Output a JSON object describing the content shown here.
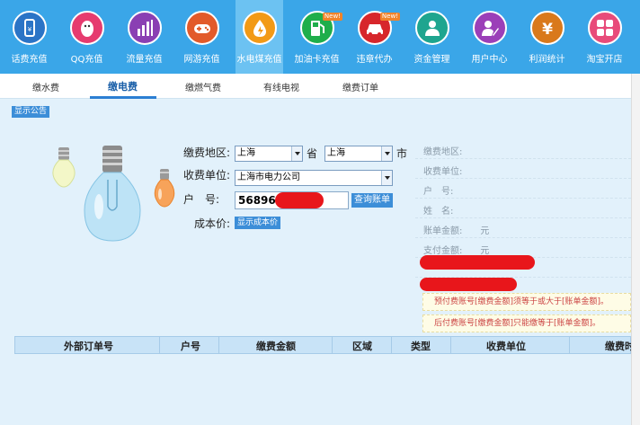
{
  "nav": {
    "items": [
      {
        "label": "话费充值",
        "icon": "phone-icon",
        "color": "#2b74c6",
        "new": false
      },
      {
        "label": "QQ充值",
        "icon": "qq-penguin-icon",
        "color": "#e63b6f",
        "new": false
      },
      {
        "label": "流量充值",
        "icon": "bar-chart-icon",
        "color": "#8a3fb3",
        "new": false
      },
      {
        "label": "网游充值",
        "icon": "gamepad-icon",
        "color": "#e25a2a",
        "new": false
      },
      {
        "label": "水电煤充值",
        "icon": "water-fire-icon",
        "color": "#f29a16",
        "new": false
      },
      {
        "label": "加油卡充值",
        "icon": "fuel-pump-icon",
        "color": "#1fae4b",
        "new": true
      },
      {
        "label": "违章代办",
        "icon": "car-icon",
        "color": "#d7262b",
        "new": true
      },
      {
        "label": "资金管理",
        "icon": "user-money-icon",
        "color": "#1ea58f",
        "new": false
      },
      {
        "label": "用户中心",
        "icon": "user-edit-icon",
        "color": "#9b3fb8",
        "new": false
      },
      {
        "label": "利润统计",
        "icon": "yen-icon",
        "color": "#d9791b",
        "new": false
      },
      {
        "label": "淘宝开店",
        "icon": "taobao-icon",
        "color": "#e84b7a",
        "new": false
      }
    ],
    "new_badge": "New!"
  },
  "subtabs": [
    {
      "label": "缴水费",
      "active": false
    },
    {
      "label": "缴电费",
      "active": true
    },
    {
      "label": "缴燃气费",
      "active": false
    },
    {
      "label": "有线电视",
      "active": false
    },
    {
      "label": "缴费订单",
      "active": false
    }
  ],
  "notice_label": "显示公告",
  "form": {
    "region_label": "缴费地区:",
    "province_value": "上海",
    "province_unit": "省",
    "city_value": "上海",
    "city_unit": "市",
    "unit_label": "收费单位:",
    "unit_value": "上海市电力公司",
    "account_label": "户　号:",
    "account_value": "568965",
    "query_button": "查询账单",
    "cost_label": "成本价:",
    "cost_button": "显示成本价"
  },
  "right_panel": {
    "rows": [
      "缴费地区:",
      "收费单位:",
      "户　号:",
      "姓　名:",
      "账单金额:　　元",
      "支付金额:　　元"
    ]
  },
  "notes": [
    "预付费账号[缴费金额]须等于或大于[账单金额]。",
    "后付费账号[缴费金额]只能缴等于[账单金额]。"
  ],
  "table": {
    "headers": [
      "外部订单号",
      "户号",
      "缴费金额",
      "区域",
      "类型",
      "收费单位",
      "缴费时间"
    ]
  },
  "colors": {
    "nav_bg": "#3aa6e8",
    "nav_active": "#6cc2f2",
    "page_bg": "#e2f1fb",
    "accent": "#2b7fd3",
    "redaction": "#e8161b"
  }
}
